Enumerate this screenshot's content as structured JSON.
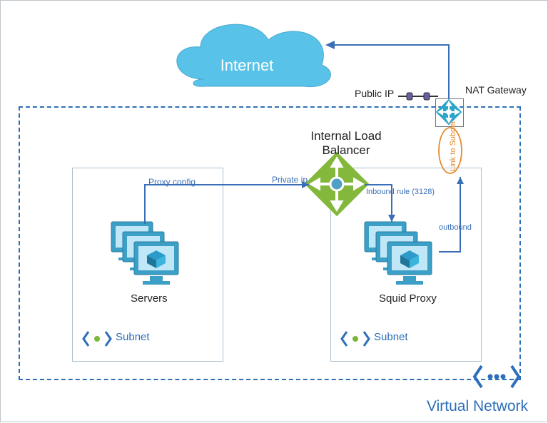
{
  "diagram": {
    "cloud_label": "Internet",
    "public_ip_label": "Public IP",
    "nat_gateway_label": "NAT Gateway",
    "load_balancer_label_1": "Internal Load",
    "load_balancer_label_2": "Balancer",
    "vnet_label": "Virtual Network",
    "link_to_subnet_label": "Link to Subnet",
    "left_group_title": "Servers",
    "right_group_title": "Squid Proxy",
    "subnet_label_left": "Subnet",
    "subnet_label_right": "Subnet",
    "edge_proxy_config": "Proxy config",
    "edge_private_ip": "Private ip",
    "edge_inbound": "Inbound rule (3128)",
    "edge_outbound": "outbound"
  }
}
